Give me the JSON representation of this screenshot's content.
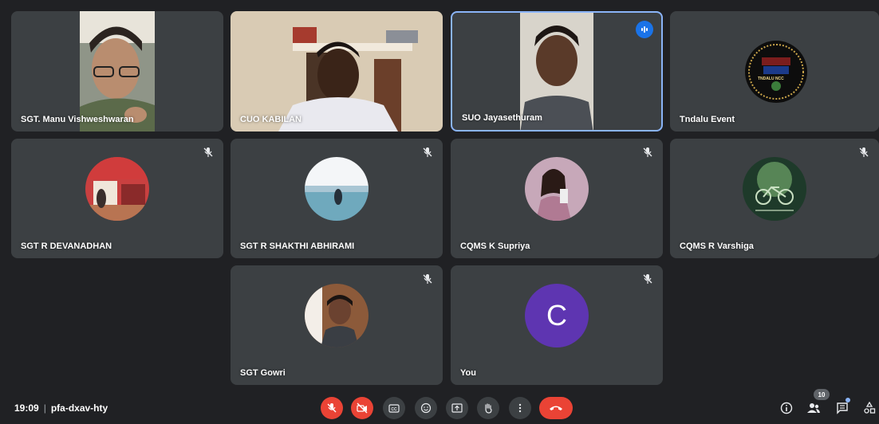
{
  "meeting": {
    "time": "19:09",
    "separator": "|",
    "code": "pfa-dxav-hty"
  },
  "tiles": {
    "manu": {
      "name": "SGT. Manu Vishweshwaran"
    },
    "kabilan": {
      "name": "CUO KABILAN"
    },
    "jaya": {
      "name": "SUO Jayasethuram"
    },
    "event": {
      "name": "Tndalu Event",
      "logo_text": "TNDALU NCC"
    },
    "devanadhan": {
      "name": "SGT R DEVANADHAN"
    },
    "shakthi": {
      "name": "SGT R SHAKTHI ABHIRAMI"
    },
    "supriya": {
      "name": "CQMS K Supriya"
    },
    "varshiga": {
      "name": "CQMS R Varshiga"
    },
    "gowri": {
      "name": "SGT Gowri"
    },
    "you": {
      "name": "You",
      "initial": "C"
    }
  },
  "toolbar": {
    "people_count": "10",
    "icons": [
      "mic-off-icon",
      "camera-off-icon",
      "captions-icon",
      "emoji-icon",
      "present-icon",
      "raise-hand-icon",
      "more-options-icon",
      "end-call-icon"
    ],
    "right_icons": [
      "info-icon",
      "people-icon",
      "chat-icon",
      "activities-icon"
    ]
  },
  "colors": {
    "background": "#202124",
    "tile": "#3c4043",
    "speaking_border": "#8ab4f8",
    "danger": "#ea4335",
    "you_avatar": "#5e35b1",
    "speaking_indicator": "#1a73e8"
  }
}
